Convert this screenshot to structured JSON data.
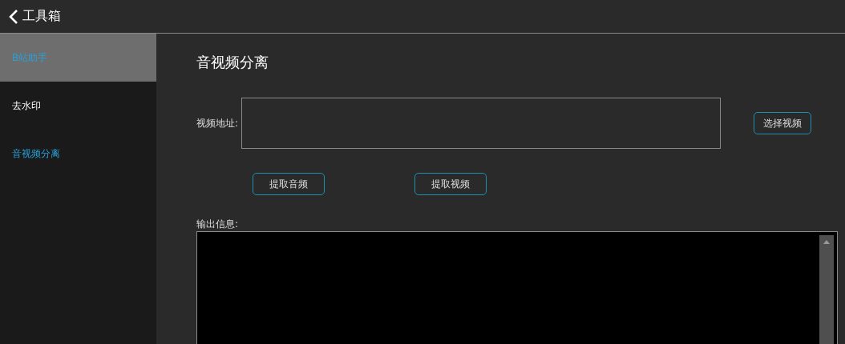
{
  "header": {
    "title": "工具箱"
  },
  "sidebar": {
    "items": [
      {
        "label": "B站助手",
        "selected": true,
        "active": true
      },
      {
        "label": "去水印",
        "selected": false,
        "active": false
      },
      {
        "label": "音视频分离",
        "selected": false,
        "active": true
      }
    ]
  },
  "main": {
    "title": "音视频分离",
    "video_field": {
      "label": "视频地址:"
    },
    "choose_button": "选择视频",
    "actions": [
      "提取音频",
      "提取视频"
    ],
    "output": {
      "label": "输出信息:"
    }
  }
}
